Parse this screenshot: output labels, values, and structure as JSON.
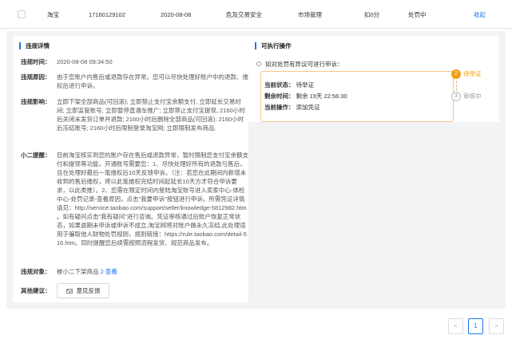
{
  "table_row": {
    "platform": "淘宝",
    "order_id": "17160129102",
    "date": "2020-08-08",
    "category": "危及交易安全",
    "type": "市场管理",
    "score": "扣0分",
    "status": "处罚中",
    "collapse_label": "收起"
  },
  "details": {
    "title": "违规详情",
    "rows": [
      {
        "label": "违规时间：",
        "value": "2020-08-08 09:34:50"
      },
      {
        "label": "违规原因：",
        "value": "由于您账户内售后或退款存在异常。您可以尽快处理好账户中的退款、维权后进行申诉。"
      },
      {
        "label": "违规影响：",
        "value": "立即下架全部商品(可回滚); 立即禁止支付宝余额支付, 立即延长交易时间; 立即监管账号; 立即暂停直通车推广; 立即禁止支付宝提现, 2160小时后关闭未发货订单并退款; 2160小时后删除全部商品(可回滚); 2160小时后冻结账号; 2160小时后限制登录淘宝网; 立即限制发布商品."
      },
      {
        "label": "小二提醒：",
        "value": "目前淘宝核实到您的账户存在售后或退款异常，暂时限制您支付宝余额支付和提现等功能，开通账号需要您：1、尽快处理好所有的退款与售后，且在处理好最后一笔维权后10天反馈申诉。（注：若您在此期间内新增未收到的售后维权，将以此笔维权完结时间起延长10天方才符合申诉要求，以此类推）。2、您需在限定时间内登陆淘宝账号进入卖家中心-体检中心-处罚记录-查看原因，点击\"我要申诉\"按钮进行申诉。所需凭证详情请见：http://service.taobao.com/support/seller/knowledge-5812982.htm 。如有疑问点击\"我有疑问\"进行咨询。凭证审核通过后账户恢复正常状态，如果逾期未申诉或申诉不成立,淘宝网将对账户做永久冻结,此处理适用于骗取他人财物处罚规则，规则链接：https://rule.taobao.com/detail-516.htm。同时提醒您后续需按照流程发货、规范商品发布。"
      },
      {
        "label": "违规对象：",
        "value": "被小二下架商品",
        "link": "2 查看"
      },
      {
        "label": "其他建议：",
        "button": "意见反馈"
      }
    ]
  },
  "actions": {
    "title": "可执行操作",
    "question": "如对处罚有异议可进行申诉：",
    "box": {
      "status_label": "当前状态：",
      "status_value": "待举证",
      "remain_label": "剩余时间：",
      "remain_value": "剩余 19天 22:56:30",
      "op_label": "当前操作：",
      "op_link": "添加凭证"
    },
    "steps": [
      {
        "num": "2",
        "label": "待举证",
        "active": true
      },
      {
        "num": "3",
        "label": "审核中",
        "active": false
      }
    ]
  },
  "pagination": {
    "prev": "<",
    "current": "1",
    "next": ">"
  },
  "colors": {
    "accent": "#1a76f2",
    "pending": "#f39c12",
    "panel_bg": "#f2f3f5"
  }
}
